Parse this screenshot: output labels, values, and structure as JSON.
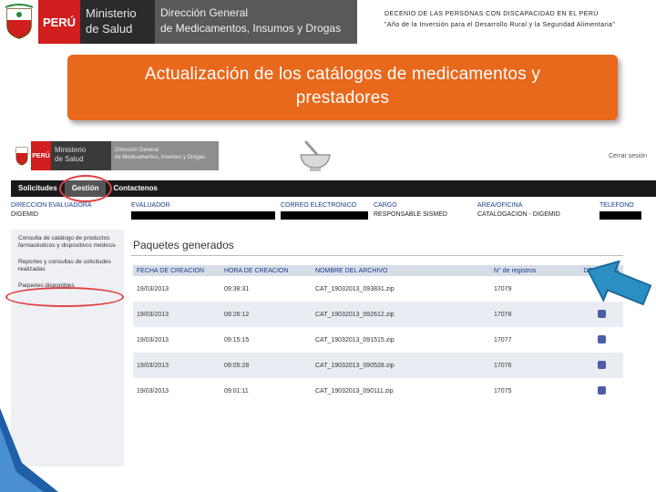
{
  "slide_header": {
    "peru": "PERÚ",
    "ministerio_line1": "Ministerio",
    "ministerio_line2": "de Salud",
    "digemid_line1": "Dirección General",
    "digemid_line2": "de Medicamentos, Insumos y Drogas",
    "decenio_line1": "DECENIO DE LAS PERSONAS CON DISCAPACIDAD EN EL PERÚ",
    "decenio_line2": "\"Año de la Inversión para el Desarrollo Rural y la Seguridad Alimentaria\""
  },
  "banner": {
    "title_line1": "Actualización de los catálogos de medicamentos y",
    "title_line2": "prestadores"
  },
  "app_header": {
    "peru": "PERÚ",
    "ministerio_line1": "Ministerio",
    "ministerio_line2": "de Salud",
    "digemid_line1": "Dirección General",
    "digemid_line2": "de Medicamentos, Insumos y Drogas",
    "logout": "Cerrar sesión"
  },
  "nav": {
    "items": [
      "Solicitudes",
      "Gestión",
      "Contactenos"
    ]
  },
  "info": {
    "headers": [
      "DIRECCION EVALUADORA",
      "EVALUADOR",
      "CORREO ELECTRONICO",
      "CARGO",
      "AREA/OFICINA",
      "TELEFONO"
    ],
    "values": [
      "DIGEMID",
      "",
      "",
      "RESPONSABLE SISMED",
      "CATALOGACION - DIGEMID",
      ""
    ]
  },
  "sidebar": {
    "items": [
      "Consulta de catálogo de productos farmacéuticos y dispositivos médicos",
      "Reportes y consultas de solicitudes realizadas",
      "Paquetes disponibles"
    ]
  },
  "packages": {
    "title": "Paquetes generados",
    "headers": [
      "FECHA DE CREACION",
      "HORA DE CREACION",
      "NOMBRE DEL ARCHIVO",
      "N° de registros",
      "DESCARGA"
    ],
    "rows": [
      {
        "fecha": "19/03/2013",
        "hora": "09:38:31",
        "archivo": "CAT_19032013_093831.zip",
        "registros": "17079"
      },
      {
        "fecha": "19/03/2013",
        "hora": "09:26:12",
        "archivo": "CAT_19032013_092612.zip",
        "registros": "17078"
      },
      {
        "fecha": "19/03/2013",
        "hora": "09:15:15",
        "archivo": "CAT_19032013_091515.zip",
        "registros": "17077"
      },
      {
        "fecha": "19/03/2013",
        "hora": "09:05:28",
        "archivo": "CAT_19032013_090528.zip",
        "registros": "17076"
      },
      {
        "fecha": "19/03/2013",
        "hora": "09:01:11",
        "archivo": "CAT_19032013_090111.zip",
        "registros": "17075"
      }
    ]
  },
  "colors": {
    "banner": "#e8681c",
    "peru_red": "#d11e1e",
    "highlight_circle": "#e04040",
    "arrow": "#2c8fc4"
  },
  "icons": [
    "peru-crest-icon",
    "mortar-pestle-icon",
    "download-icon",
    "arrow-pointer-icon"
  ]
}
